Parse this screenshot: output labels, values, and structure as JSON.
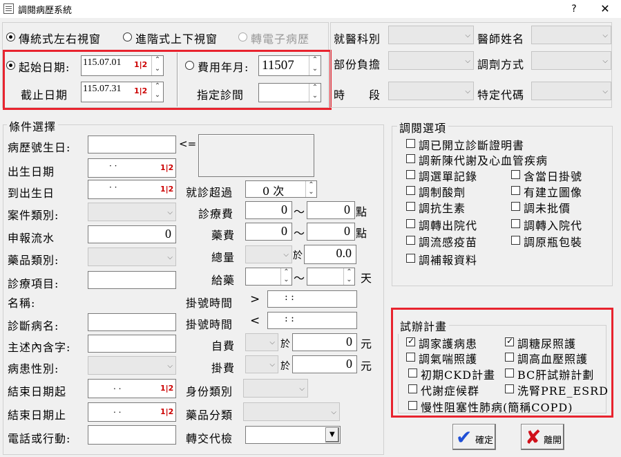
{
  "window": {
    "title": "調閱病歷系統",
    "help": "?",
    "close": "✕"
  },
  "view": {
    "traditional": "傳統式左右視窗",
    "advanced": "進階式上下視窗",
    "epr": "轉電子病歷"
  },
  "date": {
    "start_label": "起始日期:",
    "start_value": "115.07.01",
    "end_label": "截止日期",
    "end_value": "115.07.31",
    "fee_label": "費用年月:",
    "fee_value": "11507",
    "clinic_label": "指定診間",
    "cal": "1|2"
  },
  "top_right": {
    "dept": "就醫科別",
    "doctor": "醫師姓名",
    "copay": "部份負擔",
    "dispense": "調劑方式",
    "period": "時　　段",
    "special": "特定代碼"
  },
  "cond": {
    "title": "條件選擇",
    "chart_birth": "病歷號生日:",
    "arrow": "<=",
    "birthdate": "出生日期",
    "birthdate_val": "·  ·",
    "to_birthdate": "到出生日",
    "to_birthdate_val": "·  ·",
    "visit_over": "就診超過",
    "visit_over_val": "0 次",
    "case_type": "案件類別:",
    "report_seq": "申報流水",
    "report_seq_val": "0",
    "drug_type": "藥品類別:",
    "treat_item": "診療項目:",
    "name": "名稱:",
    "diagnosis": "診斷病名:",
    "complaint": "主述內含字:",
    "gender": "病患性別:",
    "end_from": "結束日期起",
    "end_from_val": ".  .",
    "end_to": "結束日期止",
    "end_to_val": ".  .",
    "phone": "電話或行動:",
    "treat_fee": "診療費",
    "treat_from": "0",
    "treat_to": "0",
    "pts": "點",
    "drug_fee": "藥費",
    "drug_from": "0",
    "drug_to": "0",
    "pts2": "點",
    "total": "總量",
    "at": "於",
    "total_val": "0.0",
    "give": "給藥",
    "day": "天",
    "tilde": "～",
    "reg_time_gt": "掛號時間",
    "gt": ">",
    "time_val": ":  :",
    "reg_time_lt": "掛號時間",
    "lt": "<",
    "time_val2": ":  :",
    "self_pay": "自費",
    "self_pay_at": "於",
    "self_pay_val": "0",
    "yuan": "元",
    "reg_fee": "掛費",
    "reg_fee_at": "於",
    "reg_fee_val": "0",
    "yuan2": "元",
    "identity": "身份類別",
    "drug_class": "藥品分類",
    "referral": "轉交代檢"
  },
  "opts": {
    "title": "調閱選項",
    "items": [
      "調已開立診斷證明書",
      "調新陳代謝及心血管疾病",
      "調選單記錄",
      "含當日掛號",
      "調制酸劑",
      "有建立圖像",
      "調抗生素",
      "調未批價",
      "調轉出院代",
      "調轉入院代",
      "調流感疫苗",
      "調原瓶包裝",
      "調補報資料"
    ]
  },
  "trial": {
    "title": "試辦計畫",
    "items": [
      "調家護病患",
      "調糖尿照護",
      "調氣喘照護",
      "調高血壓照護",
      "初期CKD計畫",
      "BC肝試辦計劃",
      "代謝症候群",
      "洗腎PRE_ESRD",
      "慢性阻塞性肺病(簡稱COPD)"
    ]
  },
  "buttons": {
    "ok": "確定",
    "leave": "離開"
  },
  "colors": {
    "highlight": "#e8232e",
    "ok_check": "#1f4fd6",
    "leave_x": "#d0101a"
  }
}
